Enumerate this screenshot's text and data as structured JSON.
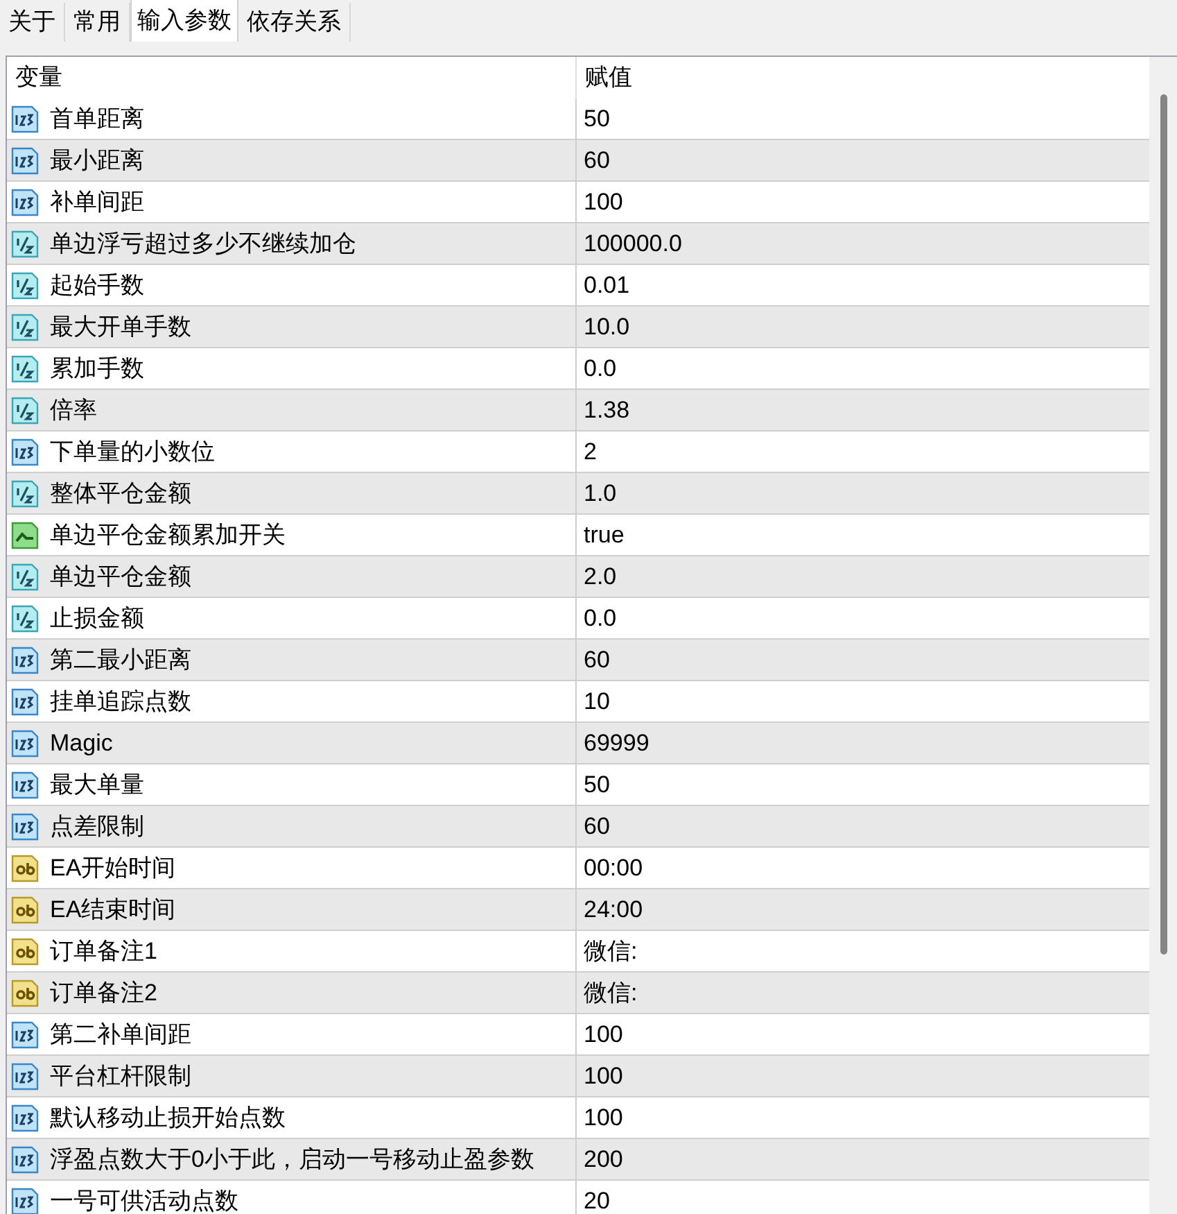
{
  "tabs": [
    {
      "label": "关于",
      "selected": false
    },
    {
      "label": "常用",
      "selected": false
    },
    {
      "label": "输入参数",
      "selected": true
    },
    {
      "label": "依存关系",
      "selected": false
    }
  ],
  "table": {
    "columns": [
      "变量",
      "赋值"
    ],
    "rows": [
      {
        "kind": "int",
        "name": "首单距离",
        "value": "50"
      },
      {
        "kind": "int",
        "name": "最小距离",
        "value": "60"
      },
      {
        "kind": "int",
        "name": "补单间距",
        "value": "100"
      },
      {
        "kind": "double",
        "name": "单边浮亏超过多少不继续加仓",
        "value": "100000.0"
      },
      {
        "kind": "double",
        "name": "起始手数",
        "value": "0.01"
      },
      {
        "kind": "double",
        "name": "最大开单手数",
        "value": "10.0"
      },
      {
        "kind": "double",
        "name": "累加手数",
        "value": "0.0"
      },
      {
        "kind": "double",
        "name": "倍率",
        "value": "1.38"
      },
      {
        "kind": "int",
        "name": "下单量的小数位",
        "value": "2"
      },
      {
        "kind": "double",
        "name": "整体平仓金额",
        "value": "1.0"
      },
      {
        "kind": "bool",
        "name": "单边平仓金额累加开关",
        "value": "true"
      },
      {
        "kind": "double",
        "name": "单边平仓金额",
        "value": "2.0"
      },
      {
        "kind": "double",
        "name": "止损金额",
        "value": "0.0"
      },
      {
        "kind": "int",
        "name": "第二最小距离",
        "value": "60"
      },
      {
        "kind": "int",
        "name": "挂单追踪点数",
        "value": "10"
      },
      {
        "kind": "int",
        "name": "Magic",
        "value": "69999"
      },
      {
        "kind": "int",
        "name": "最大单量",
        "value": "50"
      },
      {
        "kind": "int",
        "name": "点差限制",
        "value": "60"
      },
      {
        "kind": "string",
        "name": "EA开始时间",
        "value": "00:00"
      },
      {
        "kind": "string",
        "name": "EA结束时间",
        "value": "24:00"
      },
      {
        "kind": "string",
        "name": "订单备注1",
        "value": "微信:"
      },
      {
        "kind": "string",
        "name": "订单备注2",
        "value": "微信:"
      },
      {
        "kind": "int",
        "name": "第二补单间距",
        "value": "100"
      },
      {
        "kind": "int",
        "name": "平台杠杆限制",
        "value": "100"
      },
      {
        "kind": "int",
        "name": "默认移动止损开始点数",
        "value": "100"
      },
      {
        "kind": "int",
        "name": "浮盈点数大于0小于此，启动一号移动止盈参数",
        "value": "200"
      },
      {
        "kind": "int",
        "name": "一号可供活动点数",
        "value": "20"
      }
    ]
  }
}
